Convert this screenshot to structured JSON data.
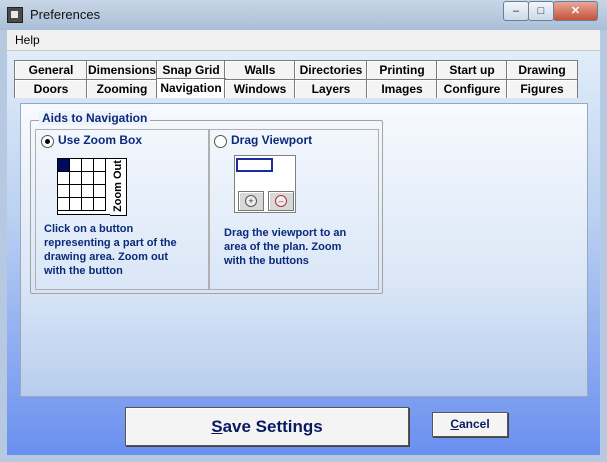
{
  "window": {
    "title": "Preferences",
    "minimize_label": "–",
    "maximize_label": "□",
    "close_label": "✕"
  },
  "menu": {
    "help": "Help"
  },
  "tabs_row1": [
    "General",
    "Dimensions",
    "Snap Grid",
    "Walls",
    "Directories",
    "Printing",
    "Start up",
    "Drawing"
  ],
  "tabs_row2": [
    "Doors",
    "Zooming",
    "Navigation",
    "Windows",
    "Layers",
    "Images",
    "Configure",
    "Figures"
  ],
  "selected_tab": "Navigation",
  "navigation": {
    "group_title": "Aids to Navigation",
    "option_zoom_box": {
      "label": "Use  Zoom Box",
      "selected": true
    },
    "zoom_out_label": "Zoom Out",
    "zoom_box_desc": [
      "Click on a button",
      "representing a part of the",
      "drawing area. Zoom out",
      "with the button"
    ],
    "option_drag_viewport": {
      "label": "Drag Viewport",
      "selected": false
    },
    "drag_viewport_desc": [
      "Drag the viewport to an",
      "area of the plan. Zoom",
      "with the buttons"
    ],
    "zoom_in_icon": "zoom-in-icon",
    "zoom_minus_icon": "zoom-minus-icon"
  },
  "buttons": {
    "save": "Save Settings",
    "cancel": "Cancel"
  }
}
